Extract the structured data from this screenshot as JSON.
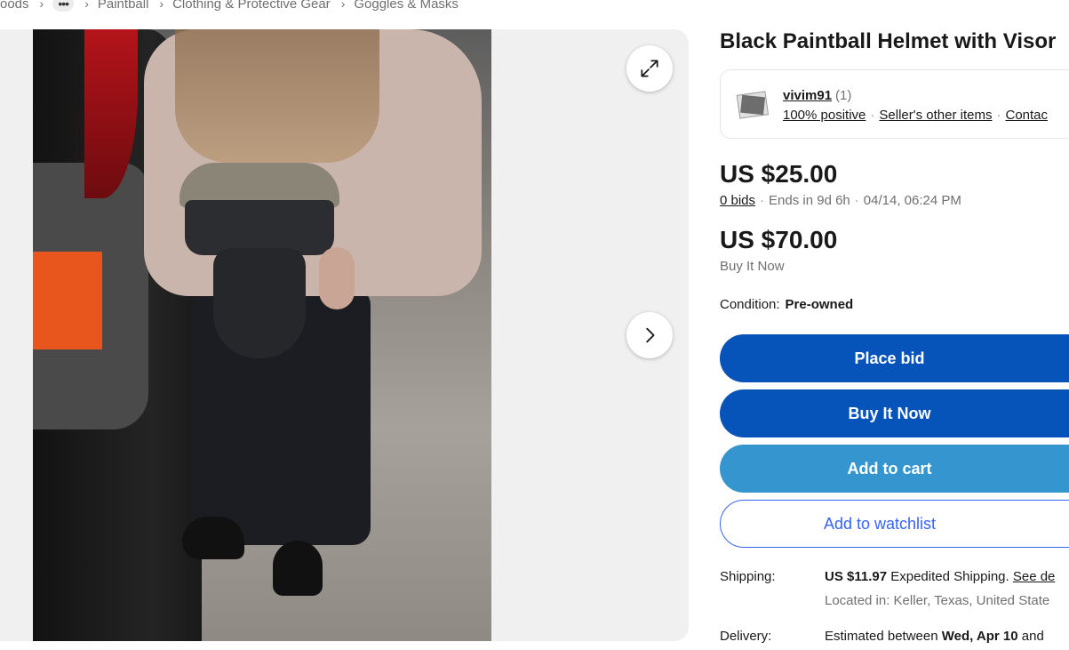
{
  "breadcrumb": {
    "items": [
      "oods",
      "Paintball",
      "Clothing & Protective Gear",
      "Goggles & Masks"
    ],
    "more_label": "•••"
  },
  "gallery": {
    "image_alt": "Black Paintball Helmet with Visor",
    "expand_icon": "expand-icon",
    "next_icon": "chevron-right-icon"
  },
  "item": {
    "title": "Black Paintball Helmet with Visor"
  },
  "seller": {
    "name": "vivim91",
    "score": "(1)",
    "positive": "100% positive",
    "other_items": "Seller's other items",
    "contact": "Contac"
  },
  "auction": {
    "current_price": "US $25.00",
    "bids": "0 bids",
    "ends": "Ends in 9d 6h",
    "end_time": "04/14, 06:24 PM"
  },
  "buy_now": {
    "price": "US $70.00",
    "label": "Buy It Now"
  },
  "condition": {
    "label": "Condition:",
    "value": "Pre-owned"
  },
  "actions": {
    "place_bid": "Place bid",
    "buy_it_now": "Buy It Now",
    "add_to_cart": "Add to cart",
    "add_to_watchlist": "Add to watchlist"
  },
  "shipping": {
    "label": "Shipping:",
    "price": "US $11.97",
    "method": "Expedited Shipping.",
    "see_details": "See de",
    "located": "Located in: Keller, Texas, United State"
  },
  "delivery": {
    "label": "Delivery:",
    "prefix": "Estimated between",
    "date": "Wed, Apr 10",
    "suffix": "and"
  },
  "colors": {
    "primary_button": "#0654ba",
    "secondary_button": "#3596cf",
    "watchlist_border": "#3665f3"
  }
}
